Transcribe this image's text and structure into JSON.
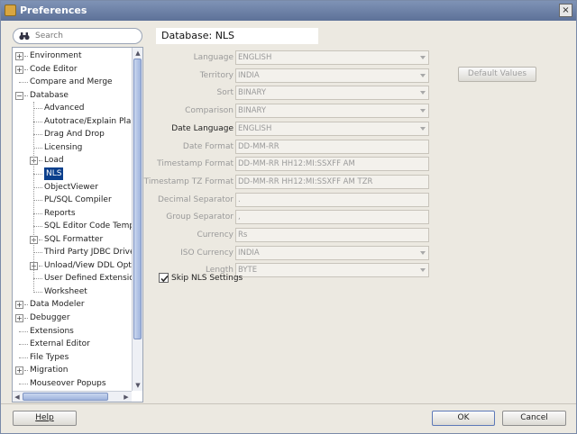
{
  "window": {
    "title": "Preferences",
    "close_glyph": "×"
  },
  "search": {
    "placeholder": "Search"
  },
  "tree": [
    {
      "label": "Environment",
      "level": 0,
      "expander": "+"
    },
    {
      "label": "Code Editor",
      "level": 0,
      "expander": "+"
    },
    {
      "label": "Compare and Merge",
      "level": 0,
      "expander": ""
    },
    {
      "label": "Database",
      "level": 0,
      "expander": "−"
    },
    {
      "label": "Advanced",
      "level": 1,
      "expander": ""
    },
    {
      "label": "Autotrace/Explain Plan",
      "level": 1,
      "expander": ""
    },
    {
      "label": "Drag And Drop",
      "level": 1,
      "expander": ""
    },
    {
      "label": "Licensing",
      "level": 1,
      "expander": ""
    },
    {
      "label": "Load",
      "level": 1,
      "expander": "+"
    },
    {
      "label": "NLS",
      "level": 1,
      "expander": "",
      "selected": true
    },
    {
      "label": "ObjectViewer",
      "level": 1,
      "expander": ""
    },
    {
      "label": "PL/SQL Compiler",
      "level": 1,
      "expander": ""
    },
    {
      "label": "Reports",
      "level": 1,
      "expander": ""
    },
    {
      "label": "SQL Editor Code Templates",
      "level": 1,
      "expander": ""
    },
    {
      "label": "SQL Formatter",
      "level": 1,
      "expander": "+"
    },
    {
      "label": "Third Party JDBC Drivers",
      "level": 1,
      "expander": ""
    },
    {
      "label": "Unload/View DDL Options",
      "level": 1,
      "expander": "+"
    },
    {
      "label": "User Defined Extensions",
      "level": 1,
      "expander": ""
    },
    {
      "label": "Worksheet",
      "level": 1,
      "expander": ""
    },
    {
      "label": "Data Modeler",
      "level": 0,
      "expander": "+"
    },
    {
      "label": "Debugger",
      "level": 0,
      "expander": "+"
    },
    {
      "label": "Extensions",
      "level": 0,
      "expander": ""
    },
    {
      "label": "External Editor",
      "level": 0,
      "expander": ""
    },
    {
      "label": "File Types",
      "level": 0,
      "expander": ""
    },
    {
      "label": "Migration",
      "level": 0,
      "expander": "+"
    },
    {
      "label": "Mouseover Popups",
      "level": 0,
      "expander": ""
    }
  ],
  "panel": {
    "title": "Database: NLS",
    "default_values_label": "Default Values",
    "fields": [
      {
        "label": "Language",
        "value": "ENGLISH",
        "dropdown": true,
        "enabled": false
      },
      {
        "label": "Territory",
        "value": "INDIA",
        "dropdown": true,
        "enabled": false
      },
      {
        "label": "Sort",
        "value": "BINARY",
        "dropdown": true,
        "enabled": false
      },
      {
        "label": "Comparison",
        "value": "BINARY",
        "dropdown": true,
        "enabled": false
      },
      {
        "label": "Date Language",
        "value": "ENGLISH",
        "dropdown": true,
        "enabled": true
      },
      {
        "label": "Date Format",
        "value": "DD-MM-RR",
        "dropdown": false,
        "enabled": false
      },
      {
        "label": "Timestamp Format",
        "value": "DD-MM-RR HH12:MI:SSXFF AM",
        "dropdown": false,
        "enabled": false
      },
      {
        "label": "Timestamp TZ Format",
        "value": "DD-MM-RR HH12:MI:SSXFF AM TZR",
        "dropdown": false,
        "enabled": false
      },
      {
        "label": "Decimal Separator",
        "value": ".",
        "dropdown": false,
        "enabled": false
      },
      {
        "label": "Group Separator",
        "value": ",",
        "dropdown": false,
        "enabled": false
      },
      {
        "label": "Currency",
        "value": "Rs",
        "dropdown": false,
        "enabled": false
      },
      {
        "label": "ISO Currency",
        "value": "INDIA",
        "dropdown": true,
        "enabled": false
      },
      {
        "label": "Length",
        "value": "BYTE",
        "dropdown": true,
        "enabled": false
      }
    ],
    "skip_nls": {
      "label": "Skip NLS Settings",
      "checked": true
    }
  },
  "footer": {
    "help_label": "Help",
    "ok_label": "OK",
    "cancel_label": "Cancel"
  }
}
